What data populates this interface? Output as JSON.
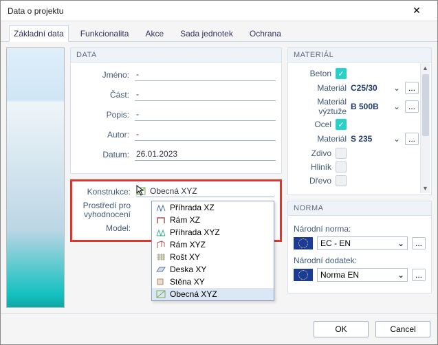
{
  "window": {
    "title": "Data o projektu"
  },
  "tabs": {
    "t0": "Základní data",
    "t1": "Funkcionalita",
    "t2": "Akce",
    "t3": "Sada jednotek",
    "t4": "Ochrana"
  },
  "data_panel": {
    "head": "DATA",
    "rows": {
      "jmeno": {
        "label": "Jméno:",
        "value": "-"
      },
      "cast": {
        "label": "Část:",
        "value": "-"
      },
      "popis": {
        "label": "Popis:",
        "value": "-"
      },
      "autor": {
        "label": "Autor:",
        "value": "-"
      },
      "datum": {
        "label": "Datum:",
        "value": "26.01.2023"
      }
    }
  },
  "konstrukce": {
    "label": "Konstrukce:",
    "value": "Obecná XYZ",
    "options": [
      "Příhrada XZ",
      "Rám XZ",
      "Příhrada XYZ",
      "Rám XYZ",
      "Rošt XY",
      "Deska XY",
      "Stěna XY",
      "Obecná XYZ"
    ]
  },
  "other_rows": {
    "prostredi": "Prostředí pro vyhodnocení",
    "model": "Model:"
  },
  "material": {
    "head": "MATERIÁL",
    "rows": [
      {
        "label": "Beton",
        "checked": true,
        "value": "",
        "extras": false
      },
      {
        "label": "Materiál",
        "checked": null,
        "value": "C25/30",
        "extras": true
      },
      {
        "label": "Materiál výztuže",
        "checked": null,
        "value": "B 500B",
        "extras": true
      },
      {
        "label": "Ocel",
        "checked": true,
        "value": "",
        "extras": false
      },
      {
        "label": "Materiál",
        "checked": null,
        "value": "S 235",
        "extras": true
      },
      {
        "label": "Zdivo",
        "checked": false,
        "value": "",
        "extras": false
      },
      {
        "label": "Hliník",
        "checked": false,
        "value": "",
        "extras": false
      },
      {
        "label": "Dřevo",
        "checked": false,
        "value": "",
        "extras": false
      }
    ]
  },
  "norma": {
    "head": "NORMA",
    "l1": "Národní norma:",
    "v1": "EC - EN",
    "l2": "Národní dodatek:",
    "v2": "Norma EN"
  },
  "footer": {
    "ok": "OK",
    "cancel": "Cancel"
  },
  "glyphs": {
    "check": "✓",
    "caret": "⌄",
    "dots": "...",
    "up": "▲",
    "down": "▼",
    "close": "✕"
  }
}
